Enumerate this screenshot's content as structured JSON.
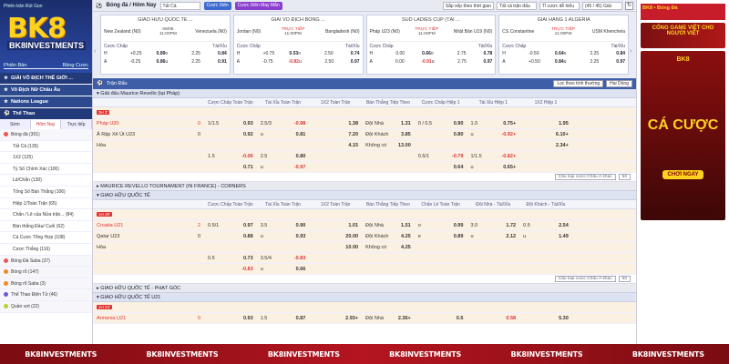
{
  "brand": {
    "small_text": "Phiên bản Rút Gọn",
    "logo_big": "BK8",
    "logo_sub": "BK8INVESTMENTS",
    "mode_left": "Phiên Bản",
    "mode_right": "Bảng Cược"
  },
  "sidebar": {
    "sections": [
      {
        "label": "GIẢI VÔ ĐỊCH THẾ GIỚI ..."
      },
      {
        "label": "Vô Địch Nữ Châu Âu"
      },
      {
        "label": "Nations League"
      },
      {
        "label": "Thể Thao"
      }
    ],
    "tabs": [
      "Sớm",
      "Hôm Nay",
      "Trực tiếp"
    ],
    "top_item": "Bóng đá (301)",
    "items": [
      "Tất Cả (135)",
      "1X2 (125)",
      "Tỷ Số Chính Xác (106)",
      "Lẻ/Chẵn (130)",
      "Tổng Số Bàn Thắng (106)",
      "Hiệp 1/Toàn Trận (65)",
      "Chấn / Lẻ của Nửa trận... (84)",
      "Bàn thắng Đầu/ Cuối (62)",
      "Cá Cược Tổng Hợp (108)",
      "Cược Thắng (116)"
    ],
    "sports": [
      "Bóng Đá Saba (37)",
      "Bóng rổ (147)",
      "Bóng rổ Saba (3)",
      "Thể Thao Điện Tử (46)",
      "Quần vợt (22)"
    ]
  },
  "topbar": {
    "title": "Bóng đá / Hôm Nay",
    "select_all": "Tất Cả",
    "btn_bet": "Cược Xiên",
    "btn_lucky": "Cược Xiên May Mắn",
    "sort_label": "Sắp xếp theo thời gian",
    "filter_label": "Tất cả trận đấu",
    "display_label": "Tỉ cược dễ hiểu",
    "count_label": "(45 / 45) Giải"
  },
  "cards": [
    {
      "league": "GIAO HỮU QUỐC TẾ ...",
      "home": "New Zealand (N0)",
      "away": "Venezuela (N0)",
      "date": "06/05",
      "time": "11:00PM",
      "odds": [
        {
          "lab": "H",
          "h": "+0.25",
          "hv": "0.89",
          "ou": "o",
          "ov": "2.25",
          "o2": "0.84"
        },
        {
          "lab": "A",
          "h": "-0.25",
          "hv": "0.86",
          "ou": "u",
          "ov": "2.25",
          "o2": "0.91"
        }
      ]
    },
    {
      "league": "GIẢI VÔ ĐỊCH BÓNG ...",
      "home": "Jordan (N0)",
      "away": "Bangladesh (N0)",
      "date": "TRỰC TIẾP",
      "time": "11:00PM",
      "odds": [
        {
          "lab": "H",
          "h": "+0.75",
          "hv": "0.53",
          "ou": "o",
          "ov": "2.50",
          "o2": "0.74"
        },
        {
          "lab": "A",
          "h": "-0.75",
          "hv": "-0.82",
          "ou": "u",
          "ov": "2.50",
          "o2": "0.97"
        }
      ]
    },
    {
      "league": "SUD LADIES CUP (TẠI ...",
      "home": "Pháp U23 (N0)",
      "away": "Nhật Bản U19 (N0)",
      "date": "TRỰC TIẾP",
      "time": "11:00PM",
      "odds": [
        {
          "lab": "H",
          "h": "0.00",
          "hv": "0.66",
          "ou": "o",
          "ov": "2.75",
          "o2": "0.78"
        },
        {
          "lab": "A",
          "h": "0.00",
          "hv": "-0.91",
          "ou": "u",
          "ov": "2.75",
          "o2": "0.97"
        }
      ]
    },
    {
      "league": "GIẢI HẠNG 1 ALGERIA",
      "home": "CS Constantine",
      "away": "USM Khenchela",
      "date": "TRỰC TIẾP",
      "time": "11:00PM",
      "odds": [
        {
          "lab": "H",
          "h": "-0.50",
          "hv": "0.64",
          "ou": "o",
          "ov": "2.25",
          "o2": "0.84"
        },
        {
          "lab": "A",
          "h": "+0.50",
          "hv": "0.84",
          "ou": "u",
          "ov": "2.25",
          "o2": "0.97"
        }
      ]
    }
  ],
  "card_headers": {
    "hdp": "Cược Chấp",
    "ou": "Tài/Xỉu"
  },
  "main": {
    "header": "Trận Đấu",
    "sort_btn": "Lọc theo tính thường",
    "mode_btn": "Hai Dòng",
    "league1": "Giải đấu Maurice Revello (tại Pháp)",
    "cols": [
      "Cược Chấp Toàn Trận",
      "Tài Xỉu Toàn Trận",
      "1X2 Toàn Trận",
      "Bàn Thắng Tiếp Theo",
      "Cược Chấp Hiệp 1",
      "Tài Xỉu Hiệp 1",
      "1X2 Hiệp 1"
    ],
    "match1": {
      "time": "3H 3'",
      "home": "Pháp U20",
      "home_score": "0",
      "away": "Ả Rập Xê Út U23",
      "away_score": "0",
      "draw": "Hòa",
      "r1": [
        "1/1.5",
        "0.93",
        "2.5/3",
        "-0.98",
        "1.38",
        "Đội Nhà",
        "1.31",
        "0 / 0.5",
        "0.90",
        "1.0",
        "0.75+",
        "1.95"
      ],
      "r2": [
        "",
        "0.92",
        "u",
        "0.81",
        "7.20",
        "Đội Khách",
        "3.85",
        "",
        "0.80",
        "u",
        "-0.92+",
        "6.10+"
      ],
      "r3": [
        "",
        "",
        "",
        "",
        "4.15",
        "Không có",
        "13.00",
        "",
        "",
        "",
        "",
        "2.34+"
      ],
      "r4": [
        "1.5",
        "-0.06",
        "2.5",
        "0.80",
        "",
        "",
        "",
        "0.5/1",
        "-0.79",
        "1/1.5",
        "-0.82+",
        ""
      ],
      "r5": [
        "",
        "0.71",
        "u",
        "-0.97",
        "",
        "",
        "",
        "",
        "0.64",
        "u",
        "0.65+",
        ""
      ]
    },
    "foot_text": "Cấu loại cược Chấu Á khác",
    "foot_count": "50",
    "league2": "MAURICE REVELLO TOURNAMENT (IN FRANCE) - CORNERS",
    "league3": "GIAO HỮU QUỐC TẾ",
    "cols2": [
      "Cược Chấp Toàn Trận",
      "Tài Xỉu Toàn Trận",
      "1X2 Toàn Trận",
      "Bàn Thắng Tiếp Theo",
      "Chấn Lẻ Toàn Trận",
      "Đội Nhà - Tài/Xỉu",
      "Đội Khách - Tài/Xỉu"
    ],
    "match2": {
      "time": "1H 48'",
      "home": "Croatia U21",
      "home_score": "2",
      "away": "Qatar U23",
      "away_score": "0",
      "draw": "Hòa",
      "r1": [
        "0.5/1",
        "0.97",
        "3.5",
        "0.90",
        "1.01",
        "Đội Nhà",
        "1.51",
        "o",
        "0.99",
        "3.0",
        "1.72",
        "0.5",
        "2.54"
      ],
      "r2": [
        "",
        "0.88",
        "u",
        "0.93",
        "20.00",
        "Đội Khách",
        "4.25",
        "e",
        "0.89",
        "u",
        "2.12",
        "u",
        "1.49"
      ],
      "r3": [
        "",
        "",
        "",
        "",
        "10.00",
        "Không có",
        "4.25",
        "",
        "",
        "",
        "",
        "",
        ""
      ],
      "r4": [
        "0.5",
        "0.73",
        "3.5/4",
        "-0.83",
        "",
        "",
        "",
        "",
        "",
        "",
        "",
        "",
        ""
      ],
      "r5": [
        "",
        "-0.83",
        "u",
        "0.66",
        "",
        "",
        "",
        "",
        "",
        "",
        "",
        "",
        ""
      ]
    },
    "league4": "GIAO HỮU QUỐC TẾ - PHẠT GÓC",
    "league5": "GIAO HỮU QUỐC TẾ U21",
    "match3": {
      "time": "1H 23'",
      "home": "Armenia U21",
      "home_score": "0",
      "r1": [
        "",
        "0.93",
        "1.5",
        "0.87",
        "2.93+",
        "Đội Nhà",
        "2.36+",
        "",
        "0.5",
        "",
        "0.58",
        "",
        "5.30"
      ]
    }
  },
  "ads": {
    "ad1": "BK8 • Bóng Đá",
    "ad2": "CỔNG GAME VIỆT CHO NGƯỜI VIỆT",
    "ad3_top": "BK8",
    "ad3_big": "CÁ CƯỢC",
    "ad3_btn": "CHƠI NGAY"
  },
  "footer": {
    "items": [
      "BK8INVESTMENTS",
      "BK8INVESTMENTS",
      "BK8INVESTMENTS",
      "BK8INVESTMENTS",
      "BK8INVESTMENTS",
      "BK8INVESTMENTS"
    ]
  }
}
